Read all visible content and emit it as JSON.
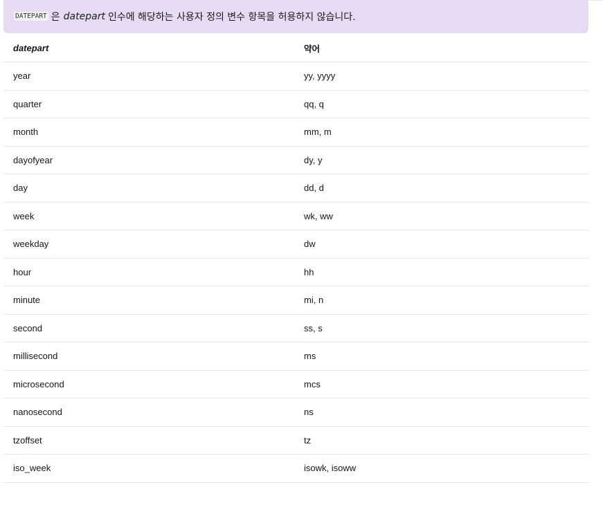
{
  "note": {
    "code": "DATEPART",
    "text_after_code": "은",
    "emphasis": "datepart",
    "text_rest": "인수에 해당하는 사용자 정의 변수 항목을 허용하지 않습니다."
  },
  "table": {
    "headers": [
      "datepart",
      "약어"
    ],
    "rows": [
      [
        "year",
        "yy, yyyy"
      ],
      [
        "quarter",
        "qq, q"
      ],
      [
        "month",
        "mm, m"
      ],
      [
        "dayofyear",
        "dy, y"
      ],
      [
        "day",
        "dd, d"
      ],
      [
        "week",
        "wk, ww"
      ],
      [
        "weekday",
        "dw"
      ],
      [
        "hour",
        "hh"
      ],
      [
        "minute",
        "mi, n"
      ],
      [
        "second",
        "ss, s"
      ],
      [
        "millisecond",
        "ms"
      ],
      [
        "microsecond",
        "mcs"
      ],
      [
        "nanosecond",
        "ns"
      ],
      [
        "tzoffset",
        "tz"
      ],
      [
        "iso_week",
        "isowk, isoww"
      ]
    ]
  },
  "colors": {
    "note_background": "#e5dcf3",
    "row_border": "#e6e6e6",
    "text": "#161616"
  }
}
